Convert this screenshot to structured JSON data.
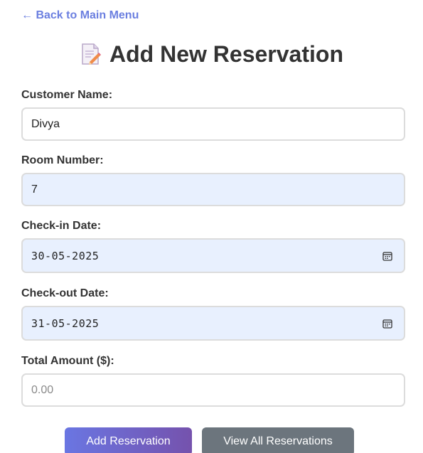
{
  "nav": {
    "back_label": "← Back to Main Menu"
  },
  "header": {
    "title": "Add New Reservation",
    "icon": "memo-icon"
  },
  "form": {
    "customer_name": {
      "label": "Customer Name:",
      "value": "Divya"
    },
    "room_number": {
      "label": "Room Number:",
      "value": "7"
    },
    "check_in": {
      "label": "Check-in Date:",
      "value": "30-05-2025",
      "icon": "calendar-icon"
    },
    "check_out": {
      "label": "Check-out Date:",
      "value": "31-05-2025",
      "icon": "calendar-icon"
    },
    "total_amount": {
      "label": "Total Amount ($):",
      "value": "",
      "placeholder": "0.00"
    }
  },
  "actions": {
    "add_label": "Add Reservation",
    "view_label": "View All Reservations"
  },
  "colors": {
    "link": "#6b7fe0",
    "filled_input_bg": "#e8f0fe",
    "primary_gradient_start": "#6a76e2",
    "primary_gradient_end": "#7552ad",
    "secondary_button": "#6c757d"
  }
}
